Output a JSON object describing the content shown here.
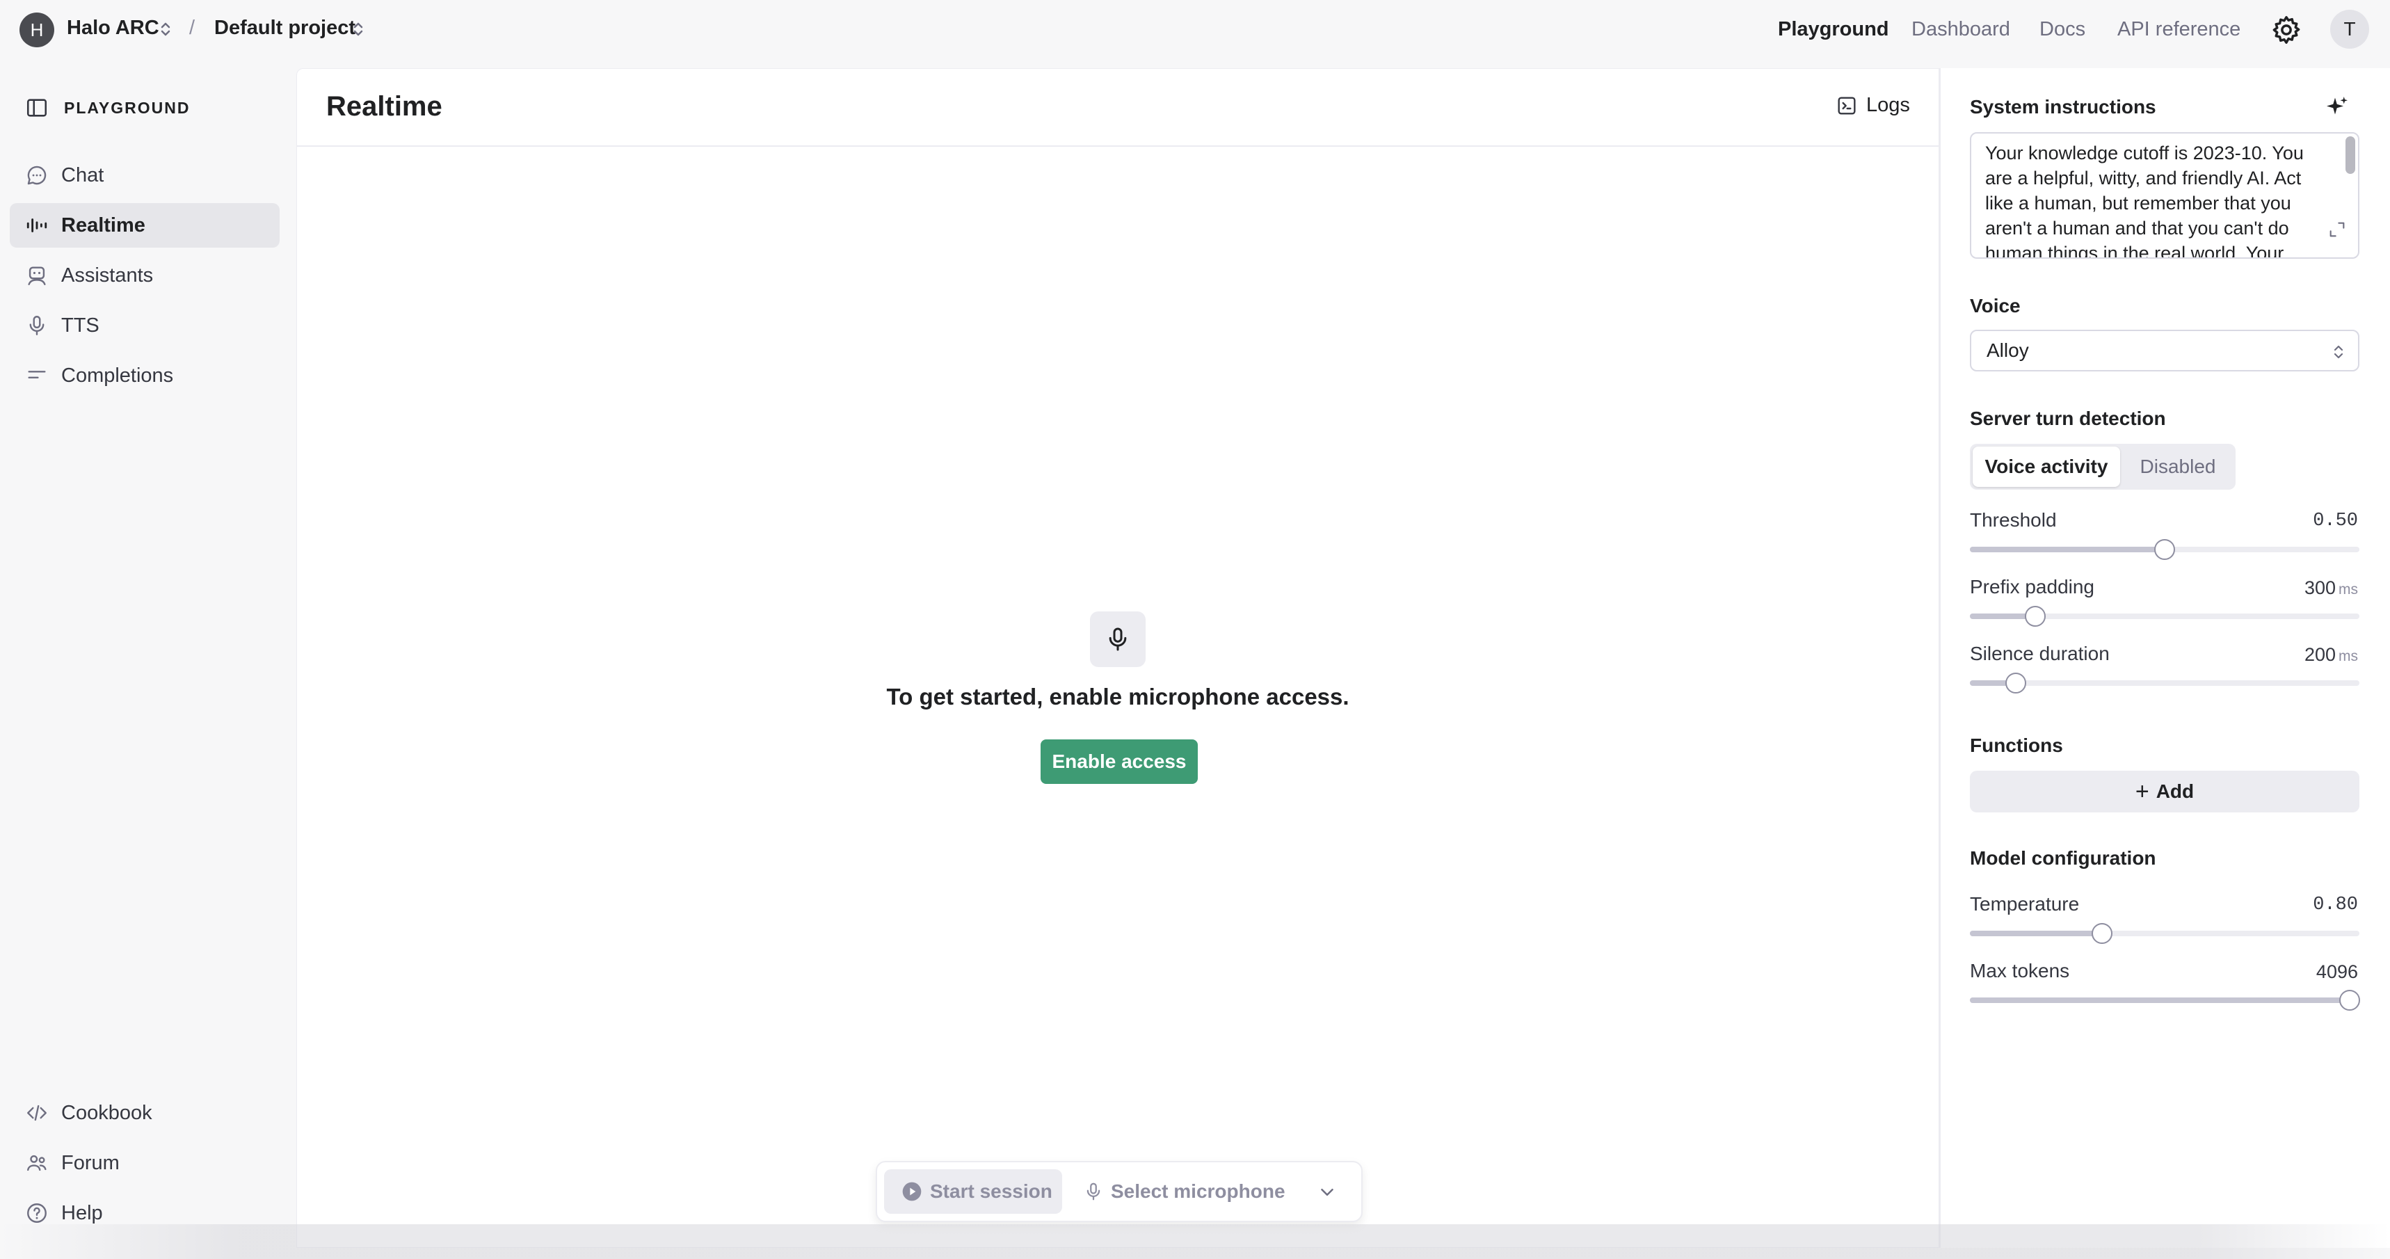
{
  "topbar": {
    "org_initial": "H",
    "org_name": "Halo ARC",
    "separator": "/",
    "project_name": "Default project",
    "nav": [
      "Playground",
      "Dashboard",
      "Docs",
      "API reference"
    ],
    "active_nav": "Playground",
    "user_initial": "T"
  },
  "sidebar": {
    "header": "PLAYGROUND",
    "items": [
      {
        "label": "Chat",
        "icon": "chat-bubble-icon"
      },
      {
        "label": "Realtime",
        "icon": "audio-bars-icon",
        "active": true
      },
      {
        "label": "Assistants",
        "icon": "robot-icon"
      },
      {
        "label": "TTS",
        "icon": "microphone-icon"
      },
      {
        "label": "Completions",
        "icon": "text-lines-icon"
      }
    ],
    "footer_items": [
      {
        "label": "Cookbook",
        "icon": "code-icon"
      },
      {
        "label": "Forum",
        "icon": "people-icon"
      },
      {
        "label": "Help",
        "icon": "help-circle-icon"
      }
    ]
  },
  "main": {
    "title": "Realtime",
    "logs_label": "Logs",
    "empty_message": "To get started, enable microphone access.",
    "enable_button": "Enable access",
    "session": {
      "start_label": "Start session",
      "select_mic_label": "Select microphone"
    }
  },
  "settings": {
    "system_instructions": {
      "title": "System instructions",
      "text": "Your knowledge cutoff is 2023-10. You are a helpful, witty, and friendly AI. Act like a human, but remember that you aren't a human and that you can't do human things in the real world. Your"
    },
    "voice": {
      "title": "Voice",
      "selected": "Alloy"
    },
    "turn_detection": {
      "title": "Server turn detection",
      "options": [
        "Voice activity",
        "Disabled"
      ],
      "selected": "Voice activity"
    },
    "threshold": {
      "label": "Threshold",
      "value": "0.50",
      "fraction": 0.5
    },
    "prefix_padding": {
      "label": "Prefix padding",
      "value": "300",
      "unit": "ms",
      "fraction": 0.167
    },
    "silence_duration": {
      "label": "Silence duration",
      "value": "200",
      "unit": "ms",
      "fraction": 0.118
    },
    "functions": {
      "title": "Functions",
      "add_label": "Add"
    },
    "model_config": {
      "title": "Model configuration",
      "temperature": {
        "label": "Temperature",
        "value": "0.80",
        "fraction": 0.34
      },
      "max_tokens": {
        "label": "Max tokens",
        "value": "4096",
        "fraction": 0.975
      }
    }
  },
  "colors": {
    "accent_green": "#3e9b74",
    "sidebar_active": "#e6e6ea",
    "page_bg": "#f7f7f8"
  }
}
